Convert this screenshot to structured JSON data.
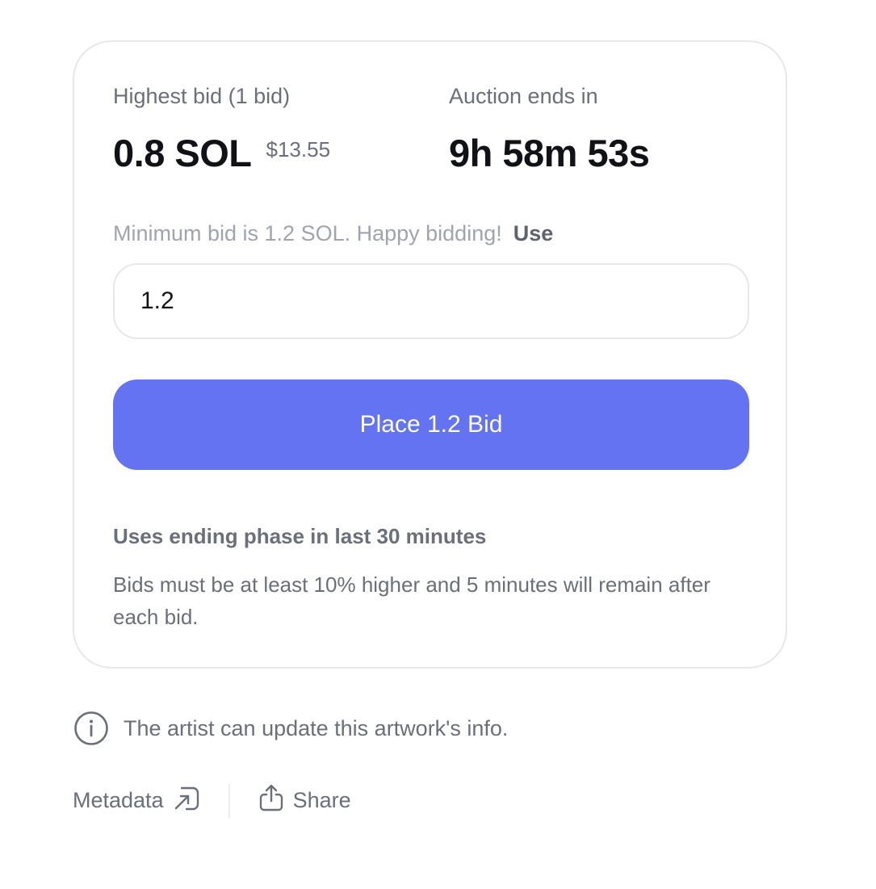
{
  "bid": {
    "label": "Highest bid (1 bid)",
    "amount": "0.8 SOL",
    "usd": "$13.55"
  },
  "auction": {
    "label": "Auction ends in",
    "countdown": "9h 58m 53s"
  },
  "minimum": {
    "text": "Minimum bid is 1.2 SOL. Happy bidding!",
    "use_label": "Use"
  },
  "input": {
    "value": "1.2"
  },
  "place_button_label": "Place 1.2 Bid",
  "ending_phase": {
    "title": "Uses ending phase in last 30 minutes",
    "description": "Bids must be at least 10% higher and 5 minutes will remain after each bid."
  },
  "info": {
    "icon": "info-icon",
    "text": "The artist can update this artwork's info."
  },
  "footer": {
    "metadata_label": "Metadata",
    "metadata_icon": "external-link-icon",
    "share_label": "Share",
    "share_icon": "share-icon"
  },
  "colors": {
    "accent": "#6373f1",
    "text_primary": "#111118",
    "text_secondary": "#6b6f7b",
    "text_muted": "#a1a4ae",
    "border": "#e8e8ec"
  }
}
